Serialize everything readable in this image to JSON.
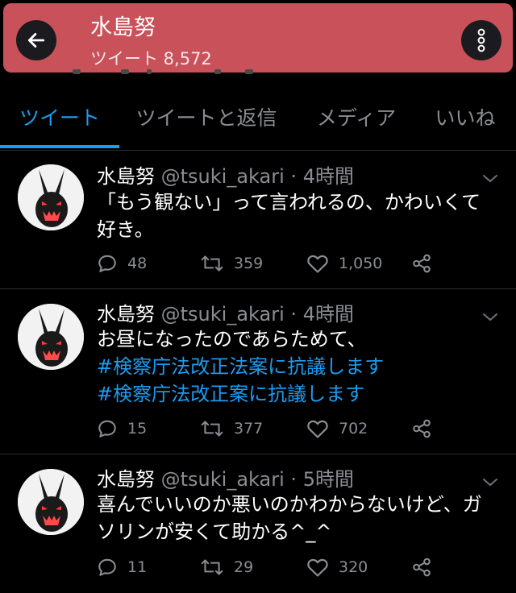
{
  "header": {
    "title": "水島努",
    "subtitle": "ツイート 8,572"
  },
  "tabs": [
    {
      "label": "ツイート",
      "active": true
    },
    {
      "label": "ツイートと返信",
      "active": false
    },
    {
      "label": "メディア",
      "active": false
    },
    {
      "label": "いいね",
      "active": false
    }
  ],
  "tweets": [
    {
      "name": "水島努",
      "handle": "@tsuki_akari",
      "separator": "·",
      "time": "4時間",
      "lines": [
        "「もう観ない」って言われるの、かわいくて",
        "好き。"
      ],
      "replies": "48",
      "retweets": "359",
      "likes": "1,050"
    },
    {
      "name": "水島努",
      "handle": "@tsuki_akari",
      "separator": "·",
      "time": "4時間",
      "lines": [
        "お昼になったのであらためて、"
      ],
      "hashtags": [
        "#検察庁法改正法案に抗議します",
        "#検察庁法改正案に抗議します"
      ],
      "replies": "15",
      "retweets": "377",
      "likes": "702"
    },
    {
      "name": "水島努",
      "handle": "@tsuki_akari",
      "separator": "·",
      "time": "5時間",
      "lines": [
        "喜んでいいのか悪いのかわからないけど、ガ",
        "ソリンが安くて助かる^_^"
      ],
      "replies": "11",
      "retweets": "29",
      "likes": "320"
    }
  ],
  "icons": {
    "back": "back-arrow-icon",
    "menu": "more-vertical-icon",
    "reply": "reply-icon",
    "retweet": "retweet-icon",
    "like": "heart-icon",
    "share": "share-icon",
    "caret": "chevron-down-icon"
  },
  "colors": {
    "header_bg": "#c8515a",
    "accent": "#1d9bf0",
    "muted": "#8a8d91",
    "background": "#000000"
  }
}
